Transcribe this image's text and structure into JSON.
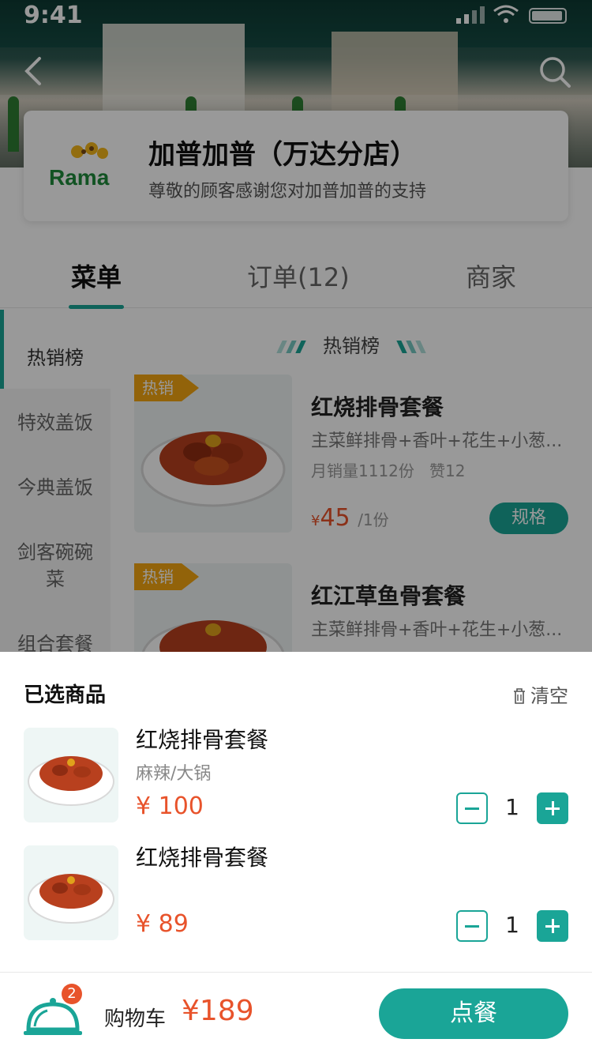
{
  "status": {
    "time": "9:41"
  },
  "store": {
    "name": "加普加普（万达分店）",
    "subtitle": "尊敬的顾客感谢您对加普加普的支持",
    "logo_text": "Rama"
  },
  "tabs": [
    {
      "label": "菜单",
      "active": true
    },
    {
      "label": "订单(12)",
      "active": false
    },
    {
      "label": "商家",
      "active": false
    }
  ],
  "sidebar": {
    "items": [
      {
        "label": "热销榜",
        "active": true
      },
      {
        "label": "特效盖饭",
        "active": false
      },
      {
        "label": "今典盖饭",
        "active": false
      },
      {
        "label": "剑客碗碗菜",
        "active": false
      },
      {
        "label": "组合套餐",
        "active": false
      }
    ]
  },
  "section": {
    "title": "热销榜"
  },
  "products": [
    {
      "tag": "热销",
      "name": "红烧排骨套餐",
      "desc": "主菜鲜排骨+香叶+花生+小葱...",
      "sales": "月销量1112份",
      "likes": "赞12",
      "currency": "¥",
      "price": "45",
      "unit": "/1份",
      "spec_label": "规格"
    },
    {
      "tag": "热销",
      "name": "红江草鱼骨套餐",
      "desc": "主菜鲜排骨+香叶+花生+小葱..."
    }
  ],
  "cart_sheet": {
    "title": "已选商品",
    "clear_label": "清空",
    "items": [
      {
        "name": "红烧排骨套餐",
        "option": "麻辣/大锅",
        "price": "¥ 100",
        "qty": "1"
      },
      {
        "name": "红烧排骨套餐",
        "option": "",
        "price": "¥ 89",
        "qty": "1"
      }
    ]
  },
  "bottom_bar": {
    "badge": "2",
    "cart_label": "购物车",
    "total": "¥189",
    "order_label": "点餐"
  },
  "colors": {
    "accent": "#1aa597",
    "price": "#e8532b",
    "hot_tag": "#f3a612"
  },
  "icons": [
    "back-icon",
    "search-icon",
    "trash-icon",
    "minus-icon",
    "plus-icon",
    "cloche-icon"
  ]
}
